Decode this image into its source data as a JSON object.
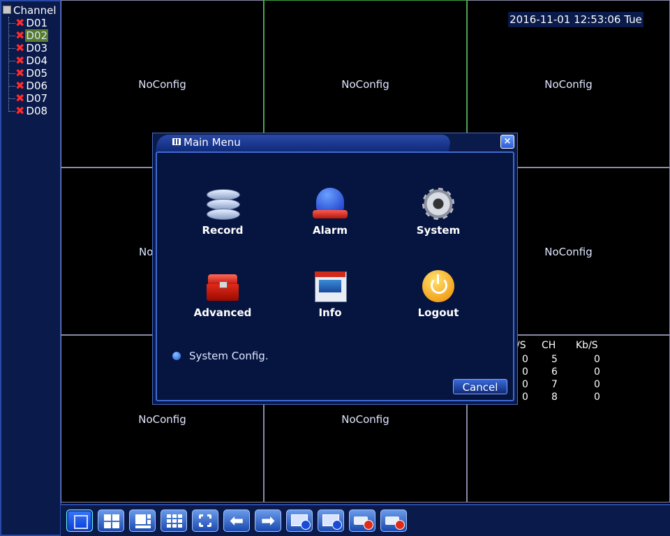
{
  "sidebar": {
    "root_label": "Channel",
    "channels": [
      {
        "label": "D01",
        "selected": false
      },
      {
        "label": "D02",
        "selected": true
      },
      {
        "label": "D03",
        "selected": false
      },
      {
        "label": "D04",
        "selected": false
      },
      {
        "label": "D05",
        "selected": false
      },
      {
        "label": "D06",
        "selected": false
      },
      {
        "label": "D07",
        "selected": false
      },
      {
        "label": "D08",
        "selected": false
      }
    ],
    "status_icon": "red-x-icon"
  },
  "datetime": "2016-11-01 12:53:06 Tue",
  "grid": {
    "cell_text": "NoConfig",
    "partial_text": "No"
  },
  "stats": {
    "headers": [
      "/S",
      "CH",
      "Kb/S"
    ],
    "rows": [
      [
        "0",
        "5",
        "0"
      ],
      [
        "0",
        "6",
        "0"
      ],
      [
        "0",
        "7",
        "0"
      ],
      [
        "0",
        "8",
        "0"
      ]
    ]
  },
  "dialog": {
    "title": "Main Menu",
    "close_label": "×",
    "items": [
      {
        "label": "Record",
        "icon": "film-reel-icon"
      },
      {
        "label": "Alarm",
        "icon": "siren-icon"
      },
      {
        "label": "System",
        "icon": "gear-icon"
      },
      {
        "label": "Advanced",
        "icon": "toolbox-icon"
      },
      {
        "label": "Info",
        "icon": "window-info-icon"
      },
      {
        "label": "Logout",
        "icon": "power-icon"
      }
    ],
    "status_text": "System Config.",
    "cancel_label": "Cancel"
  },
  "toolbar": {
    "buttons": [
      "single-view",
      "quad-view",
      "view-8",
      "view-9",
      "fullscreen",
      "previous",
      "next",
      "start-tour",
      "stop-tour",
      "record",
      "stop-record"
    ]
  },
  "colors": {
    "panel": "#0a1a4a",
    "accent": "#2a4aa8",
    "active_border": "#3aa03a",
    "error": "#ff2a2a"
  }
}
